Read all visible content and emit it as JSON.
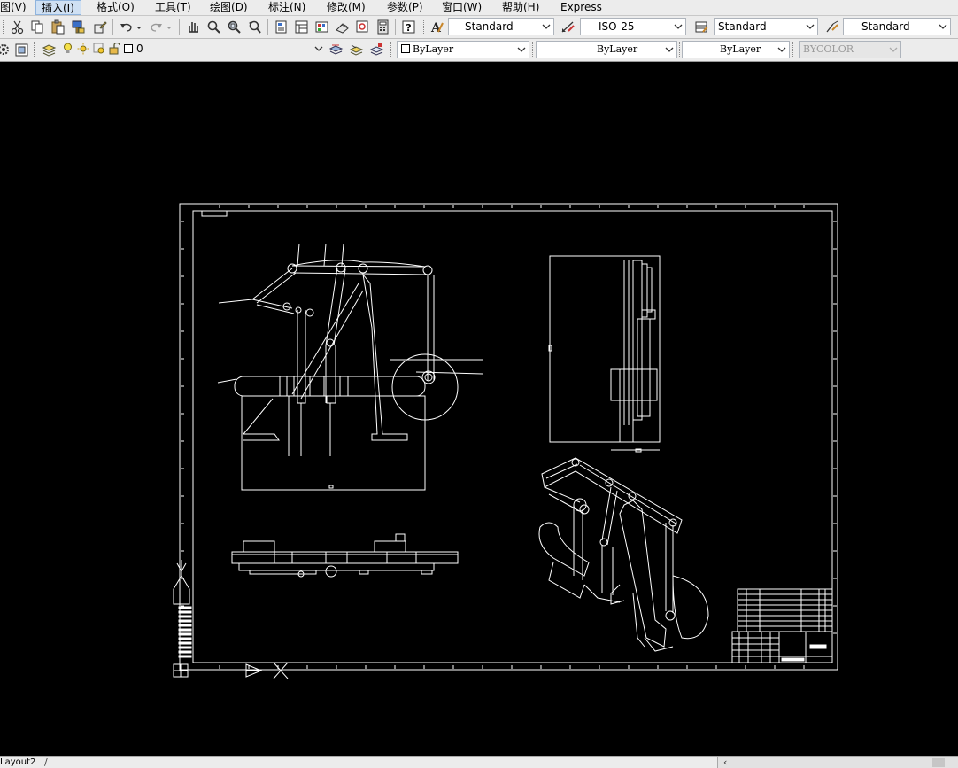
{
  "menu": {
    "view": "图(V)",
    "insert": "插入(I)",
    "format": "格式(O)",
    "tools": "工具(T)",
    "draw": "绘图(D)",
    "dimension": "标注(N)",
    "modify": "修改(M)",
    "parametric": "参数(P)",
    "window": "窗口(W)",
    "help": "帮助(H)",
    "express": "Express"
  },
  "styles_toolbar": {
    "text_style": "Standard",
    "dim_style": "ISO-25",
    "table_style": "Standard",
    "multileader_style": "Standard"
  },
  "layers_toolbar": {
    "current_layer": "0"
  },
  "properties_toolbar": {
    "color": "ByLayer",
    "linetype": "ByLayer",
    "lineweight": "ByLayer",
    "plot_style": "BYCOLOR"
  },
  "layout": {
    "tab_label": "Layout2"
  },
  "colors": {
    "canvas": "#000000",
    "drawing_lines": "#ffffff",
    "toolbar_bg": "#ececec"
  }
}
